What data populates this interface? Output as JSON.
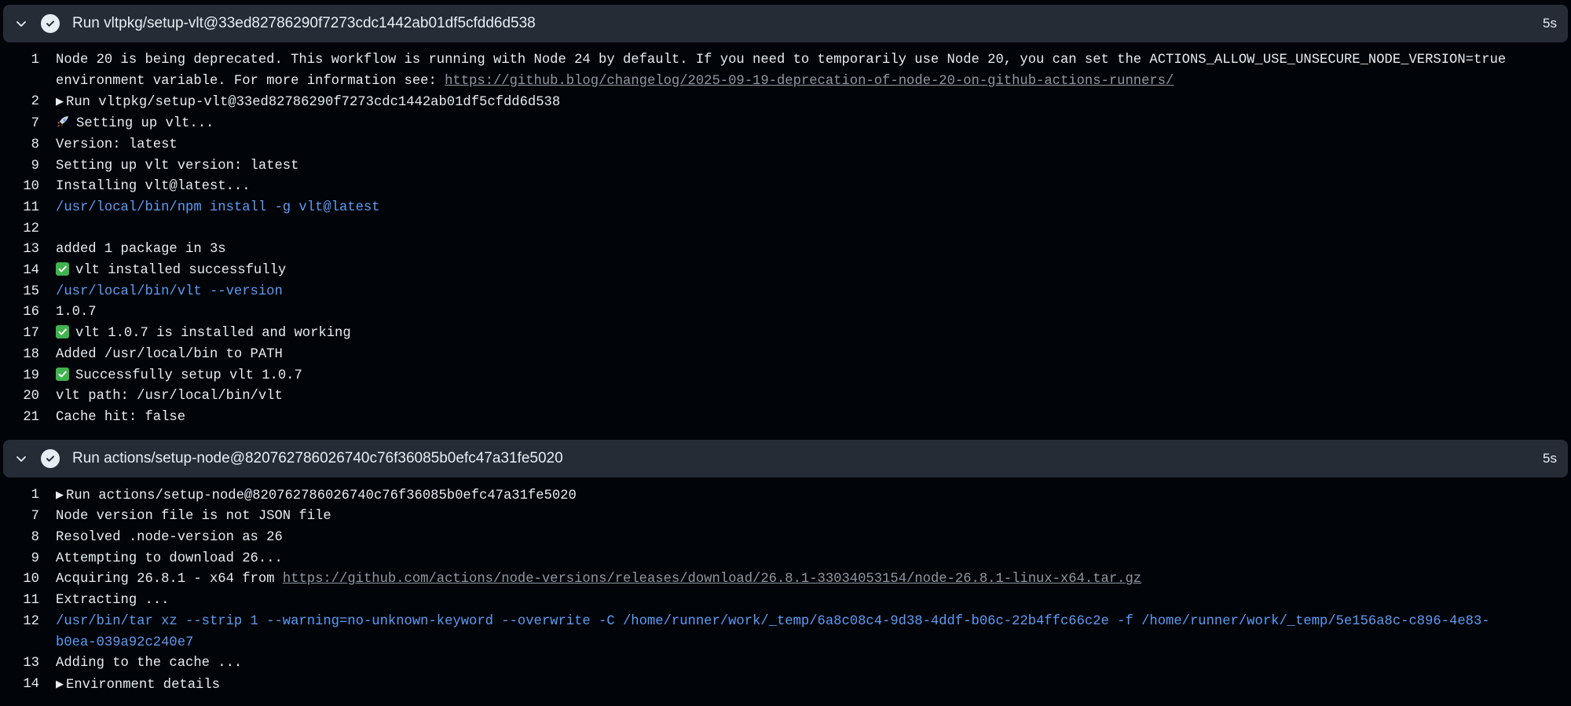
{
  "steps": [
    {
      "title": "Run vltpkg/setup-vlt@33ed82786290f7273cdc1442ab01df5cfdd6d538",
      "time": "5s",
      "icons": {
        "toggle": "chevron-down-icon",
        "status": "check-circle-icon"
      },
      "lines": [
        {
          "n": "1",
          "text": "Node 20 is being deprecated. This workflow is running with Node 24 by default. If you need to temporarily use Node 20, you can set the ACTIONS_ALLOW_USE_UNSECURE_NODE_VERSION=true environment variable. For more information see: ",
          "link": "https://github.blog/changelog/2025-09-19-deprecation-of-node-20-on-github-actions-runners/"
        },
        {
          "n": "2",
          "text": "Run vltpkg/setup-vlt@33ed82786290f7273cdc1442ab01df5cfdd6d538",
          "expandable": true
        },
        {
          "n": "7",
          "text": "Setting up vlt...",
          "emoji": "rocket-icon"
        },
        {
          "n": "8",
          "text": "Version: latest"
        },
        {
          "n": "9",
          "text": "Setting up vlt version: latest"
        },
        {
          "n": "10",
          "text": "Installing vlt@latest..."
        },
        {
          "n": "11",
          "text": "/usr/local/bin/npm install -g vlt@latest",
          "cmd": true
        },
        {
          "n": "12",
          "text": ""
        },
        {
          "n": "13",
          "text": "added 1 package in 3s"
        },
        {
          "n": "14",
          "text": "vlt installed successfully",
          "emoji": "check-mark-button-icon"
        },
        {
          "n": "15",
          "text": "/usr/local/bin/vlt --version",
          "cmd": true
        },
        {
          "n": "16",
          "text": "1.0.7"
        },
        {
          "n": "17",
          "text": "vlt 1.0.7 is installed and working",
          "emoji": "check-mark-button-icon"
        },
        {
          "n": "18",
          "text": "Added /usr/local/bin to PATH"
        },
        {
          "n": "19",
          "text": "Successfully setup vlt 1.0.7",
          "emoji": "check-mark-button-icon"
        },
        {
          "n": "20",
          "text": "vlt path: /usr/local/bin/vlt"
        },
        {
          "n": "21",
          "text": "Cache hit: false"
        }
      ]
    },
    {
      "title": "Run actions/setup-node@820762786026740c76f36085b0efc47a31fe5020",
      "time": "5s",
      "icons": {
        "toggle": "chevron-down-icon",
        "status": "check-circle-icon"
      },
      "lines": [
        {
          "n": "1",
          "text": "Run actions/setup-node@820762786026740c76f36085b0efc47a31fe5020",
          "expandable": true
        },
        {
          "n": "7",
          "text": "Node version file is not JSON file"
        },
        {
          "n": "8",
          "text": "Resolved .node-version as 26"
        },
        {
          "n": "9",
          "text": "Attempting to download 26..."
        },
        {
          "n": "10",
          "text": "Acquiring 26.8.1 - x64 from ",
          "link": "https://github.com/actions/node-versions/releases/download/26.8.1-33034053154/node-26.8.1-linux-x64.tar.gz"
        },
        {
          "n": "11",
          "text": "Extracting ..."
        },
        {
          "n": "12",
          "text": "/usr/bin/tar xz --strip 1 --warning=no-unknown-keyword --overwrite -C /home/runner/work/_temp/6a8c08c4-9d38-4ddf-b06c-22b4ffc66c2e -f /home/runner/work/_temp/5e156a8c-c896-4e83-b0ea-039a92c240e7",
          "cmd": true
        },
        {
          "n": "13",
          "text": "Adding to the cache ..."
        },
        {
          "n": "14",
          "text": "Environment details",
          "expandable": true
        }
      ]
    }
  ],
  "colors": {
    "background": "#010409",
    "header": "#262c36",
    "command": "#5d9cf5",
    "link": "#9198a1",
    "success": "#3fb34f"
  }
}
